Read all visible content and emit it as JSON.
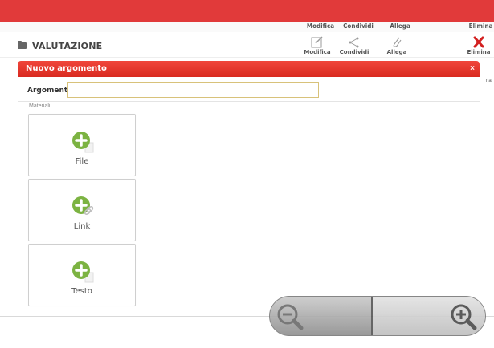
{
  "toolbar": {
    "top_labels": [
      "Modifica",
      "Condividi",
      "Allega",
      "Elimina"
    ],
    "items": [
      {
        "label": "Modifica",
        "icon": "edit-icon"
      },
      {
        "label": "Condividi",
        "icon": "share-icon"
      },
      {
        "label": "Allega",
        "icon": "paperclip-icon"
      },
      {
        "label": "Elimina",
        "icon": "delete-icon"
      }
    ]
  },
  "page": {
    "title": "VALUTAZIONE",
    "icon": "folder-icon",
    "side_fragment": "na"
  },
  "dialog": {
    "title": "Nuovo argomento",
    "close": "×",
    "field_label": "Argomento",
    "field_value": "",
    "section_label": "Materiali",
    "tiles": [
      {
        "label": "File",
        "icon": "add-file-icon"
      },
      {
        "label": "Link",
        "icon": "add-link-icon"
      },
      {
        "label": "Testo",
        "icon": "add-text-icon"
      }
    ]
  },
  "zoom": {
    "out_icon": "zoom-out-icon",
    "in_icon": "zoom-in-icon"
  },
  "colors": {
    "brand_red": "#e13a3a",
    "add_green": "#7cb342",
    "delete_red": "#d32020",
    "input_border": "#d8c27a"
  }
}
